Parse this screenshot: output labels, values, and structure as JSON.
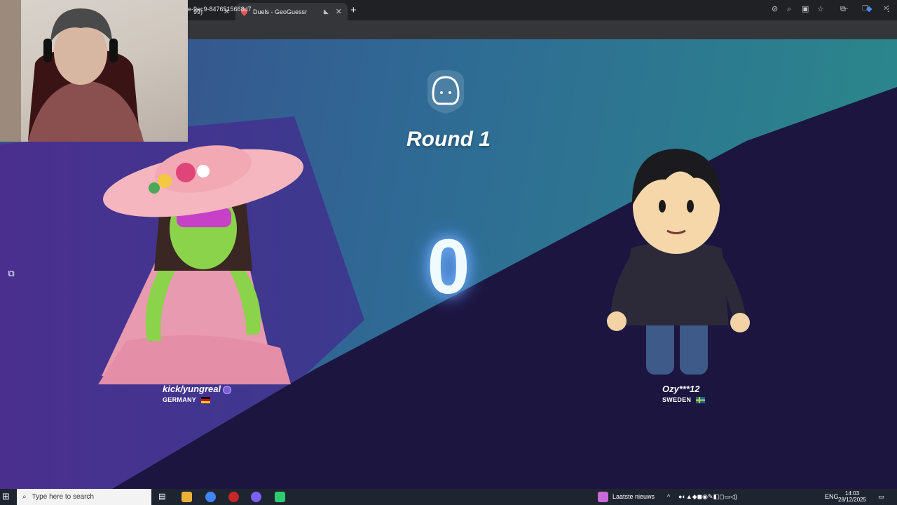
{
  "browser": {
    "tab1_label": "99)",
    "tab2_label": "Duels - GeoGuessr",
    "url": "e-9ec9-8476515668d7",
    "new_tab": "+",
    "close": "✕",
    "mute": "🔇"
  },
  "game": {
    "round_title": "Round 1",
    "timer_value": "0",
    "player_left": {
      "name": "kick/yungreal",
      "country": "GERMANY"
    },
    "player_right": {
      "name": "Ozy***12",
      "country": "SWEDEN"
    }
  },
  "taskbar": {
    "search_placeholder": "Type here to search",
    "news_label": "Laatste nieuws",
    "language": "ENG",
    "time": "14:03",
    "date": "28/12/2025"
  },
  "colors": {
    "purple_band": "#4a2f8f",
    "dark_navy": "#1c1540",
    "teal": "#2a8a8a"
  }
}
